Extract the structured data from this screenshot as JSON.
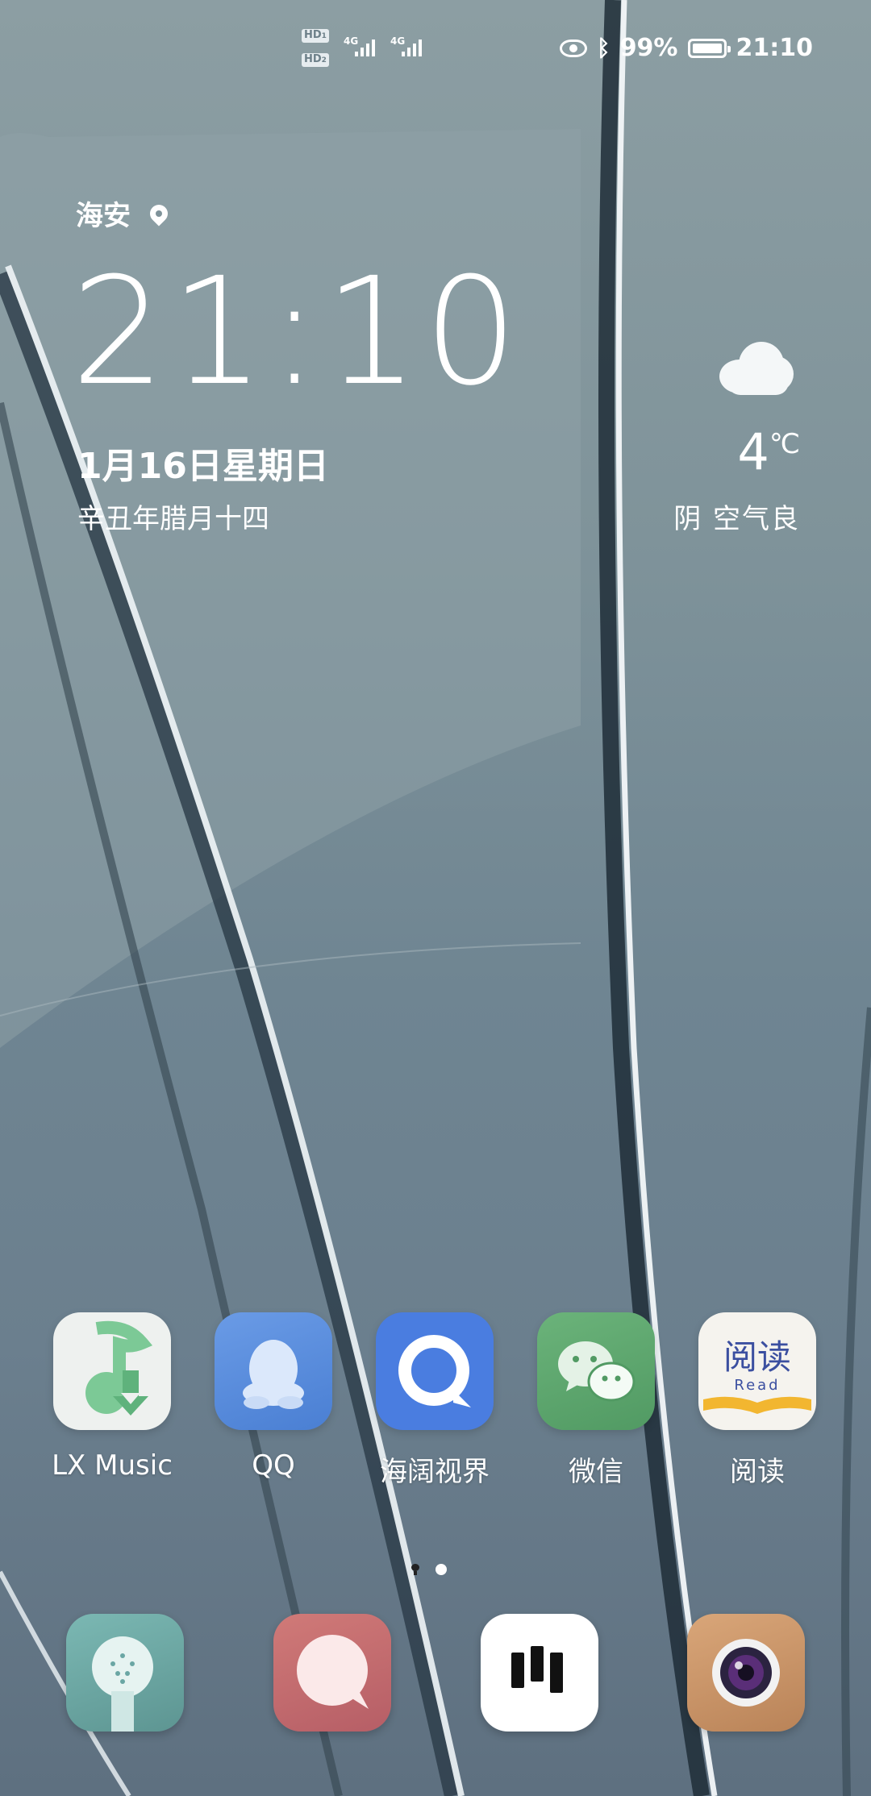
{
  "status_bar": {
    "sim1_tag": "HD",
    "sim1_num": "1",
    "sim2_tag": "HD",
    "sim2_num": "2",
    "network1": "4G",
    "network2": "4G",
    "battery": "99%",
    "time": "21:10",
    "icons": [
      "eye-comfort-icon",
      "bluetooth-icon",
      "battery-icon",
      "signal-icon"
    ]
  },
  "clock_widget": {
    "city": "海安",
    "time": "21:10",
    "date": "1月16日星期日",
    "lunar_date": "辛丑年腊月十四"
  },
  "weather_widget": {
    "icon": "cloud-icon",
    "temperature": "4",
    "unit": "℃",
    "description": "阴  空气良"
  },
  "apps": [
    {
      "label": "LX Music",
      "icon": "lx-music-icon",
      "color": "#eef1ef"
    },
    {
      "label": "QQ",
      "icon": "qq-penguin-icon",
      "color": "#5a8edb"
    },
    {
      "label": "海阔视界",
      "icon": "haikuo-icon",
      "color": "#4a7de0"
    },
    {
      "label": "微信",
      "icon": "wechat-icon",
      "color": "#5fa56c"
    },
    {
      "label": "阅读",
      "icon": "read-book-icon",
      "icon_text": "阅读",
      "icon_subtext": "Read",
      "color": "#f5f3ee"
    }
  ],
  "page_indicator": {
    "pages": 2,
    "current": 2
  },
  "dock": [
    {
      "icon": "phone-icon",
      "color": "#6aa6a4"
    },
    {
      "icon": "messages-icon",
      "color": "#c06a6e"
    },
    {
      "icon": "browser-icon",
      "color": "#ffffff"
    },
    {
      "icon": "camera-icon",
      "color": "#c8956a"
    }
  ]
}
